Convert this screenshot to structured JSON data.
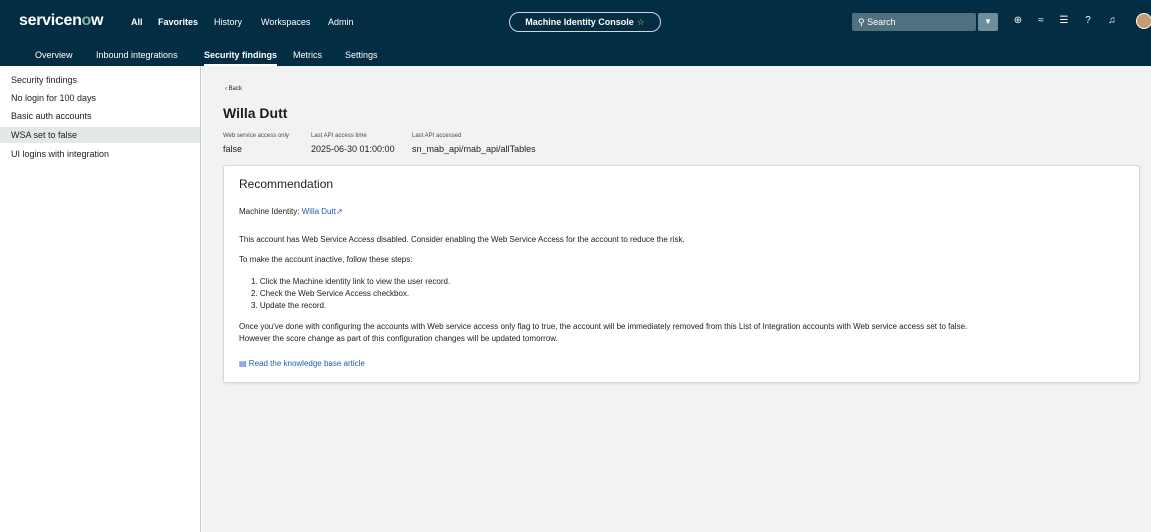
{
  "brand": {
    "logo_prefix": "servicen",
    "logo_o": "o",
    "logo_suffix": "w"
  },
  "topnav": {
    "all": "All",
    "favorites": "Favorites",
    "history": "History",
    "workspaces": "Workspaces",
    "admin": "Admin"
  },
  "context": {
    "title": "Machine Identity Console",
    "star": "☆"
  },
  "search": {
    "placeholder": "Search",
    "icon": "search-icon"
  },
  "tabs": [
    "Overview",
    "Inbound integrations",
    "Security findings",
    "Metrics",
    "Settings"
  ],
  "active_tab": "Security findings",
  "sidebar": {
    "items": [
      {
        "label": "Security findings"
      },
      {
        "label": "No login for 100 days"
      },
      {
        "label": "Basic auth accounts"
      },
      {
        "label": "WSA set to false"
      },
      {
        "label": "UI logins with integration"
      }
    ],
    "active": "WSA set to false"
  },
  "detail": {
    "back": "‹ Back",
    "title": "Willa Dutt",
    "meta": [
      {
        "label": "Web service access only",
        "value": "false"
      },
      {
        "label": "Last API access time",
        "value": "2025-06-30 01:00:00"
      },
      {
        "label": "Last API accessed",
        "value": "sn_mab_api/mab_api/allTables"
      }
    ]
  },
  "recommendation": {
    "heading": "Recommendation",
    "identity_label": "Machine Identity:",
    "identity_link": "Willa Dutt",
    "para1": "This account has Web Service Access disabled. Consider enabling the Web Service Access for the account to reduce the risk.",
    "para2": "To make the account inactive, follow these steps:",
    "steps": [
      "1. Click the Machine identity link to view the user record.",
      "2. Check the Web Service Access checkbox.",
      "3. Update the record."
    ],
    "para3a": "Once you've done with configuring the accounts with Web service access only flag to true, the account will be immediately removed from this List of Integration accounts with Web service access set to false.",
    "para3b": "However the score change as part of this configuration changes will be updated tomorrow.",
    "kb_link": "Read the knowledge base article"
  },
  "colors": {
    "header": "#032d42",
    "link": "#1f5db8",
    "active_sidebar": "#e3e9e7"
  }
}
